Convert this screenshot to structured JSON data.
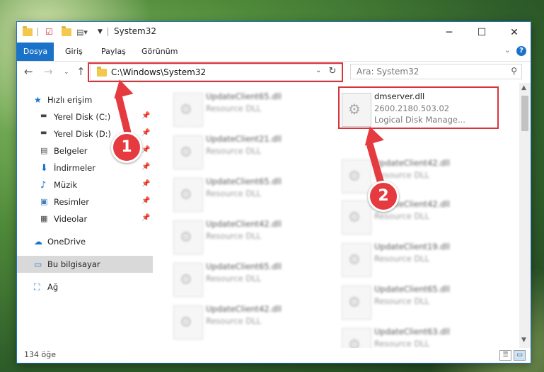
{
  "window": {
    "title": "System32",
    "controls": {
      "minimize": "─",
      "maximize": "☐",
      "close": "✕"
    }
  },
  "ribbon": {
    "tabs": [
      {
        "label": "Dosya",
        "active": true
      },
      {
        "label": "Giriş",
        "active": false
      },
      {
        "label": "Paylaş",
        "active": false
      },
      {
        "label": "Görünüm",
        "active": false
      }
    ],
    "help": "?"
  },
  "nav": {
    "address": "C:\\Windows\\System32",
    "search_placeholder": "Ara: System32"
  },
  "sidebar": {
    "items": [
      {
        "label": "Hızlı erişim",
        "icon": "star-icon",
        "pinned": false
      },
      {
        "label": "Yerel Disk (C:)",
        "icon": "drive-icon",
        "pinned": true
      },
      {
        "label": "Yerel Disk (D:)",
        "icon": "drive-icon",
        "pinned": true
      },
      {
        "label": "Belgeler",
        "icon": "documents-icon",
        "pinned": true
      },
      {
        "label": "İndirmeler",
        "icon": "download-icon",
        "pinned": true
      },
      {
        "label": "Müzik",
        "icon": "music-icon",
        "pinned": true
      },
      {
        "label": "Resimler",
        "icon": "pictures-icon",
        "pinned": true
      },
      {
        "label": "Videolar",
        "icon": "videos-icon",
        "pinned": true
      },
      {
        "label": "OneDrive",
        "icon": "cloud-icon",
        "pinned": false
      },
      {
        "label": "Bu bilgisayar",
        "icon": "computer-icon",
        "pinned": false,
        "selected": true
      },
      {
        "label": "Ağ",
        "icon": "network-icon",
        "pinned": false
      }
    ]
  },
  "files": {
    "highlighted": {
      "name": "dmserver.dll",
      "version": "2600.2180.503.02",
      "description": "Logical Disk Manage..."
    },
    "left_column": [
      {
        "name": "UpdateClient65.dll",
        "type": "Resource DLL"
      },
      {
        "name": "UpdateClient21.dll",
        "type": "Resource DLL"
      },
      {
        "name": "UpdateClient65.dll",
        "type": "Resource DLL"
      },
      {
        "name": "UpdateClient42.dll",
        "type": "Resource DLL"
      },
      {
        "name": "UpdateClient65.dll",
        "type": "Resource DLL"
      },
      {
        "name": "UpdateClient42.dll",
        "type": "Resource DLL"
      }
    ],
    "right_column": [
      {
        "name": "UpdateClient42.dll",
        "type": "Resource DLL"
      },
      {
        "name": "UpdateClient42.dll",
        "type": "Resource DLL"
      },
      {
        "name": "UpdateClient19.dll",
        "type": "Resource DLL"
      },
      {
        "name": "UpdateClient65.dll",
        "type": "Resource DLL"
      },
      {
        "name": "UpdateClient63.dll",
        "type": "Resource DLL"
      }
    ]
  },
  "status": {
    "count": "134 öğe"
  },
  "annotations": {
    "step1": "1",
    "step2": "2",
    "color": "#e53a3f"
  }
}
